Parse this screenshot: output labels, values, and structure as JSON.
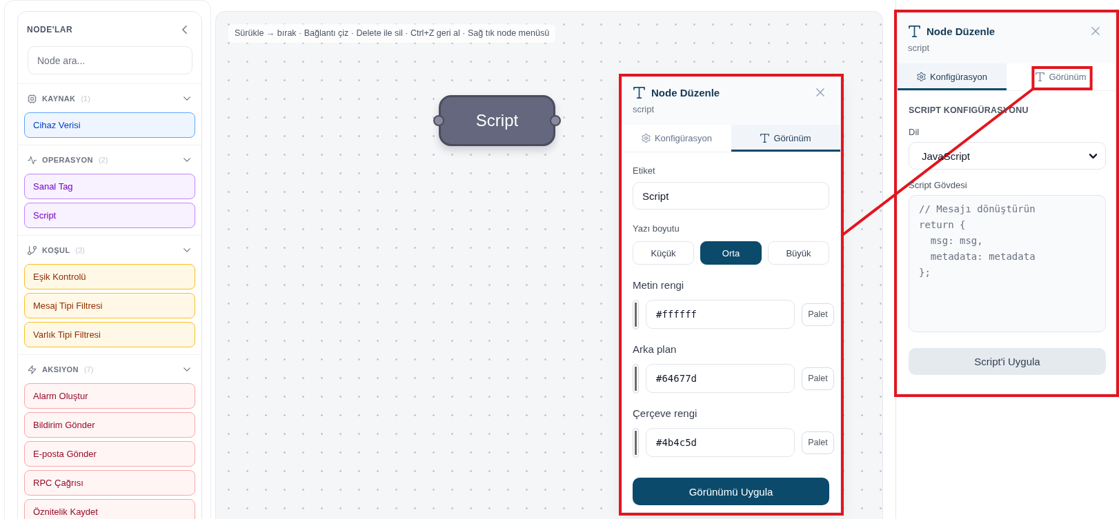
{
  "sidebar": {
    "title": "NODE'LAR",
    "search": {
      "placeholder": "Node ara..."
    },
    "groups": [
      {
        "kind": "source",
        "label": "KAYNAK",
        "count": "(1)",
        "expanded": true,
        "color": "#60a5fa",
        "items": [
          {
            "label": "Cihaz Verisi"
          }
        ]
      },
      {
        "kind": "operation",
        "label": "OPERASYON",
        "count": "(2)",
        "expanded": true,
        "color": "#c084fc",
        "items": [
          {
            "label": "Sanal Tag"
          },
          {
            "label": "Script"
          }
        ]
      },
      {
        "kind": "condition",
        "label": "KOŞUL",
        "count": "(3)",
        "expanded": true,
        "color": "#fbbf24",
        "items": [
          {
            "label": "Eşik Kontrolü"
          },
          {
            "label": "Mesaj Tipi Filtresi"
          },
          {
            "label": "Varlık Tipi Filtresi"
          }
        ]
      },
      {
        "kind": "action",
        "label": "AKSIYON",
        "count": "(7)",
        "expanded": true,
        "color": "#fca5a5",
        "items": [
          {
            "label": "Alarm Oluştur"
          },
          {
            "label": "Bildirim Gönder"
          },
          {
            "label": "E-posta Gönder"
          },
          {
            "label": "RPC Çağrısı"
          },
          {
            "label": "Öznitelik Kaydet"
          }
        ]
      }
    ]
  },
  "canvas": {
    "hint": "Sürükle → bırak · Bağlantı çiz · Delete ile sil · Ctrl+Z geri al · Sağ tık node menüsü",
    "node": {
      "label": "Script"
    }
  },
  "editors": [
    {
      "title": "Node Düzenle",
      "subtitle": "script",
      "tabs": [
        {
          "kind": "config",
          "label": "Konfigürasyon",
          "selected": false
        },
        {
          "kind": "appearance",
          "label": "Görünüm",
          "selected": true
        }
      ],
      "body": {
        "kind": "appearance",
        "label_field": {
          "label": "Etiket",
          "value": "Script"
        },
        "size_field": {
          "label": "Yazı boyutu",
          "options": [
            {
              "label": "Küçük",
              "selected": false
            },
            {
              "label": "Orta",
              "selected": true
            },
            {
              "label": "Büyük",
              "selected": false
            }
          ]
        },
        "color_fields": [
          {
            "label": "Metin rengi",
            "value": "#ffffff",
            "button": "Palet"
          },
          {
            "label": "Arka plan",
            "value": "#64677d",
            "button": "Palet"
          },
          {
            "label": "Çerçeve rengi",
            "value": "#4b4c5d",
            "button": "Palet"
          }
        ],
        "apply_button": "Görünümü Uygula"
      }
    },
    {
      "title": "Node Düzenle",
      "subtitle": "script",
      "tabs": [
        {
          "kind": "config",
          "label": "Konfigürasyon",
          "selected": true
        },
        {
          "kind": "appearance",
          "label": "Görünüm",
          "selected": false
        }
      ],
      "body": {
        "kind": "config",
        "heading": "SCRIPT KONFIGÜRASYONU",
        "language_field": {
          "label": "Dil",
          "value": "JavaScript"
        },
        "code_field": {
          "label": "Script Gövdesi",
          "lines": [
            "// Mesajı dönüştürün",
            "return {",
            "  msg: msg,",
            "  metadata: metadata",
            "};"
          ]
        },
        "apply_button": "Script'i Uygula"
      }
    }
  ]
}
